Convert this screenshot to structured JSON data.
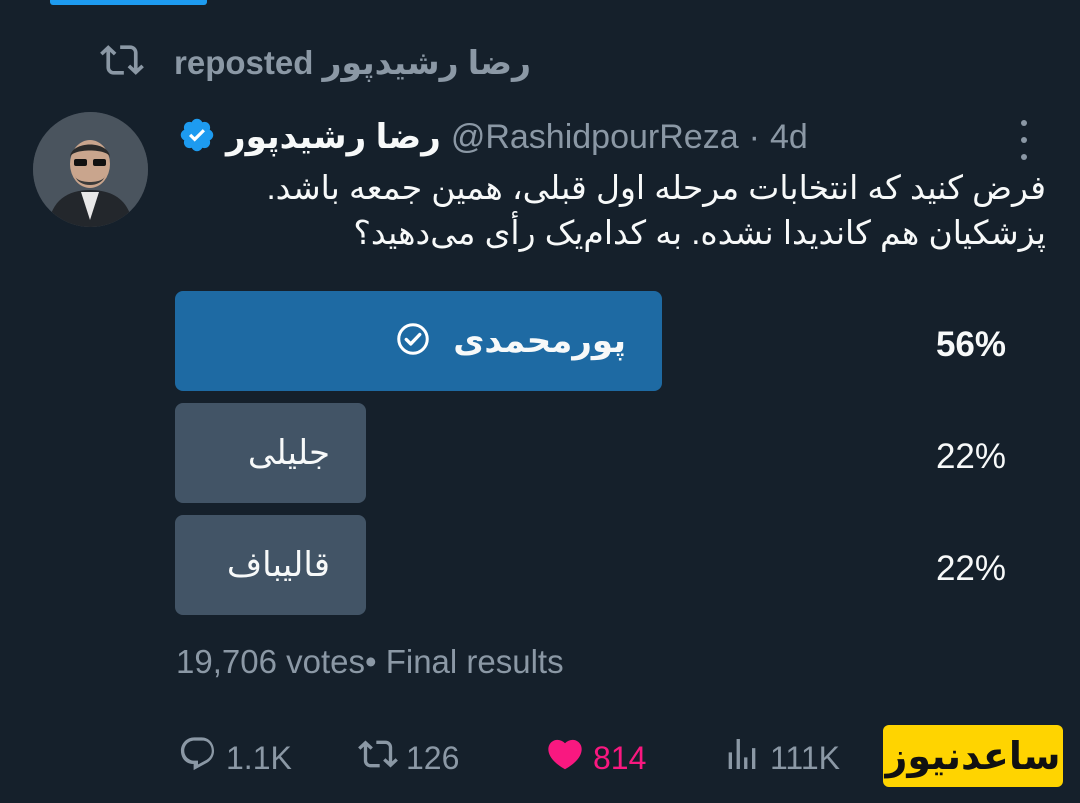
{
  "repost": {
    "reposter": "رضا رشیدپور",
    "label": "reposted",
    "icon": "repost-icon"
  },
  "author": {
    "display_name": "رضا رشیدپور",
    "handle": "@RashidpourReza",
    "time": "4d",
    "separator": "·",
    "verified_icon": "verified-badge-icon",
    "verified_color": "#1d9bf0"
  },
  "tweet": {
    "line1": "فرض کنید که انتخابات مرحله اول قبلی، همین جمعه باشد.",
    "line2": "پزشکیان هم کاندیدا نشده. به کدام‌یک رأی می‌دهید؟"
  },
  "poll": {
    "options": [
      {
        "label": "پورمحمدی",
        "percent": "56%",
        "fraction": 0.56,
        "winner": true,
        "icon": "check-circle-icon"
      },
      {
        "label": "جلیلی",
        "percent": "22%",
        "fraction": 0.22,
        "winner": false
      },
      {
        "label": "قالیباف",
        "percent": "22%",
        "fraction": 0.22,
        "winner": false
      }
    ],
    "votes": "19,706 votes",
    "status": "• Final results",
    "winner_color": "#1e6aa3",
    "option_color": "#425466"
  },
  "actions": {
    "replies": "1.1K",
    "reposts": "126",
    "likes": "814",
    "views": "111K",
    "like_color": "#f91880"
  },
  "watermark": {
    "text": "ساعدنیوز",
    "color": "#ffd400"
  }
}
